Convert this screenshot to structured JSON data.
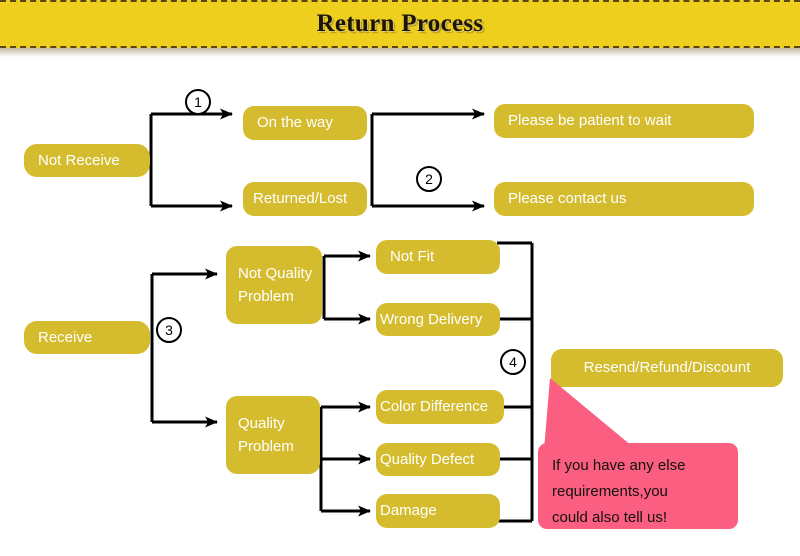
{
  "banner": {
    "title": "Return Process",
    "background_color": "#EFCF1E",
    "border_style": "dashed",
    "border_color": "#5A4410"
  },
  "theme": {
    "node_color": "#D4BC2E",
    "node_text_color": "#FFFFFF",
    "callout_color": "#FA5F82",
    "line_color": "#000000",
    "page_background": "#FFFFFF"
  },
  "flow": {
    "steps": [
      {
        "number": "1"
      },
      {
        "number": "2"
      },
      {
        "number": "3"
      },
      {
        "number": "4"
      }
    ],
    "nodes": {
      "not_receive": "Not Receive",
      "on_the_way": "On the way",
      "returned_lost": "Returned/Lost",
      "please_wait": "Please be patient to wait",
      "please_contact": "Please contact us",
      "receive": "Receive",
      "not_quality_problem": "Not Quality Problem",
      "quality_problem": "Quality Problem",
      "not_fit": "Not Fit",
      "wrong_delivery": "Wrong Delivery",
      "color_difference": "Color Difference",
      "quality_defect": "Quality Defect",
      "damage": "Damage",
      "resend_refund_discount": "Resend/Refund/Discount"
    }
  },
  "callout": {
    "line1": "If you have any else",
    "line2": "requirements,you",
    "line3": "could also tell us!"
  }
}
